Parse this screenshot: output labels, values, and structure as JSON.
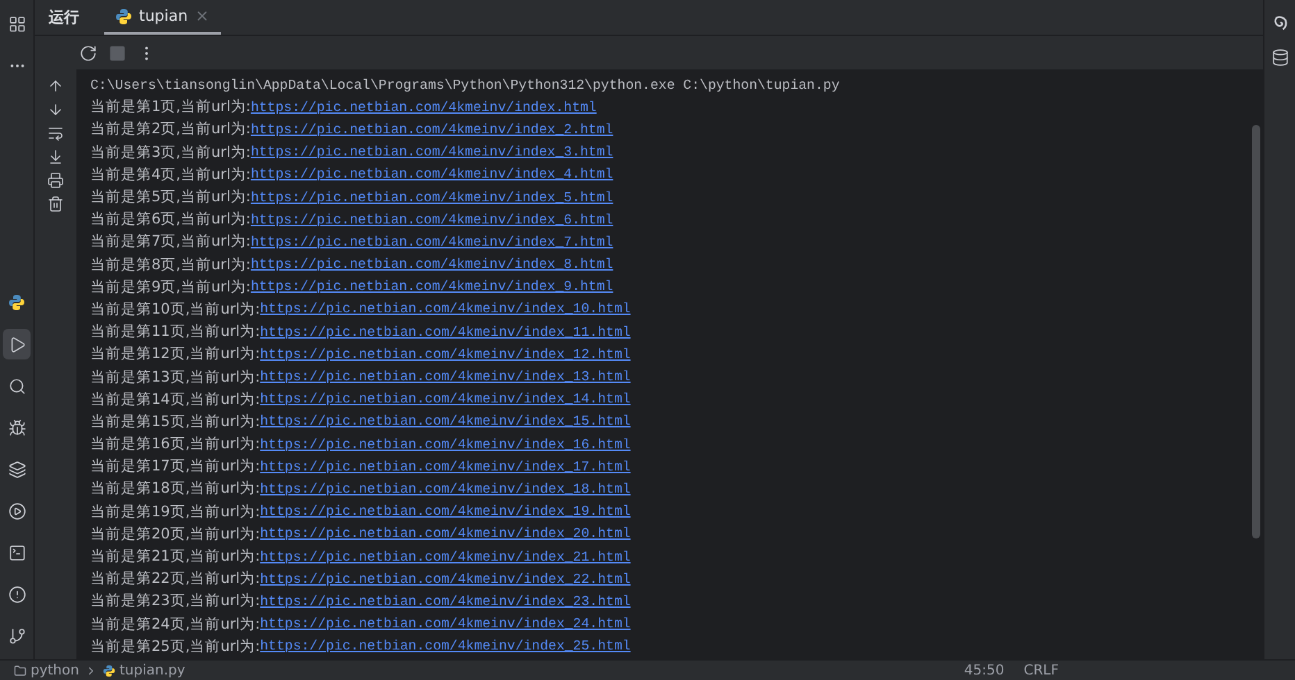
{
  "left_toolbar": {
    "top": [
      {
        "kind": "structure",
        "selected": false
      },
      {
        "kind": "more",
        "selected": false
      }
    ],
    "bottom": [
      {
        "kind": "python",
        "selected": false
      },
      {
        "kind": "run",
        "selected": true
      },
      {
        "kind": "search",
        "selected": false
      },
      {
        "kind": "debug",
        "selected": false
      },
      {
        "kind": "layers",
        "selected": false
      },
      {
        "kind": "services",
        "selected": false
      },
      {
        "kind": "terminal",
        "selected": false
      },
      {
        "kind": "problems",
        "selected": false
      },
      {
        "kind": "git",
        "selected": false
      }
    ]
  },
  "run_panel": {
    "title": "运行",
    "tabs": [
      {
        "label": "tupian",
        "selected": true
      }
    ],
    "actions": [
      {
        "kind": "rerun"
      },
      {
        "kind": "stop"
      },
      {
        "kind": "more"
      }
    ],
    "side_actions": [
      {
        "kind": "up"
      },
      {
        "kind": "down"
      },
      {
        "kind": "wrap"
      },
      {
        "kind": "scroll-end"
      },
      {
        "kind": "print"
      },
      {
        "kind": "trash"
      }
    ],
    "command": "C:\\Users\\tiansonglin\\AppData\\Local\\Programs\\Python\\Python312\\python.exe C:\\python\\tupian.py",
    "lines": [
      {
        "prefix": "当前是第1页,当前url为:",
        "url": "https://pic.netbian.com/4kmeinv/index.html"
      },
      {
        "prefix": "当前是第2页,当前url为:",
        "url": "https://pic.netbian.com/4kmeinv/index_2.html"
      },
      {
        "prefix": "当前是第3页,当前url为:",
        "url": "https://pic.netbian.com/4kmeinv/index_3.html"
      },
      {
        "prefix": "当前是第4页,当前url为:",
        "url": "https://pic.netbian.com/4kmeinv/index_4.html"
      },
      {
        "prefix": "当前是第5页,当前url为:",
        "url": "https://pic.netbian.com/4kmeinv/index_5.html"
      },
      {
        "prefix": "当前是第6页,当前url为:",
        "url": "https://pic.netbian.com/4kmeinv/index_6.html"
      },
      {
        "prefix": "当前是第7页,当前url为:",
        "url": "https://pic.netbian.com/4kmeinv/index_7.html"
      },
      {
        "prefix": "当前是第8页,当前url为:",
        "url": "https://pic.netbian.com/4kmeinv/index_8.html"
      },
      {
        "prefix": "当前是第9页,当前url为:",
        "url": "https://pic.netbian.com/4kmeinv/index_9.html"
      },
      {
        "prefix": "当前是第10页,当前url为:",
        "url": "https://pic.netbian.com/4kmeinv/index_10.html"
      },
      {
        "prefix": "当前是第11页,当前url为:",
        "url": "https://pic.netbian.com/4kmeinv/index_11.html"
      },
      {
        "prefix": "当前是第12页,当前url为:",
        "url": "https://pic.netbian.com/4kmeinv/index_12.html"
      },
      {
        "prefix": "当前是第13页,当前url为:",
        "url": "https://pic.netbian.com/4kmeinv/index_13.html"
      },
      {
        "prefix": "当前是第14页,当前url为:",
        "url": "https://pic.netbian.com/4kmeinv/index_14.html"
      },
      {
        "prefix": "当前是第15页,当前url为:",
        "url": "https://pic.netbian.com/4kmeinv/index_15.html"
      },
      {
        "prefix": "当前是第16页,当前url为:",
        "url": "https://pic.netbian.com/4kmeinv/index_16.html"
      },
      {
        "prefix": "当前是第17页,当前url为:",
        "url": "https://pic.netbian.com/4kmeinv/index_17.html"
      },
      {
        "prefix": "当前是第18页,当前url为:",
        "url": "https://pic.netbian.com/4kmeinv/index_18.html"
      },
      {
        "prefix": "当前是第19页,当前url为:",
        "url": "https://pic.netbian.com/4kmeinv/index_19.html"
      },
      {
        "prefix": "当前是第20页,当前url为:",
        "url": "https://pic.netbian.com/4kmeinv/index_20.html"
      },
      {
        "prefix": "当前是第21页,当前url为:",
        "url": "https://pic.netbian.com/4kmeinv/index_21.html"
      },
      {
        "prefix": "当前是第22页,当前url为:",
        "url": "https://pic.netbian.com/4kmeinv/index_22.html"
      },
      {
        "prefix": "当前是第23页,当前url为:",
        "url": "https://pic.netbian.com/4kmeinv/index_23.html"
      },
      {
        "prefix": "当前是第24页,当前url为:",
        "url": "https://pic.netbian.com/4kmeinv/index_24.html"
      },
      {
        "prefix": "当前是第25页,当前url为:",
        "url": "https://pic.netbian.com/4kmeinv/index_25.html"
      }
    ]
  },
  "right_toolbar": [
    {
      "kind": "spiral"
    },
    {
      "kind": "database"
    }
  ],
  "status_bar": {
    "breadcrumb": [
      "python",
      "tupian.py"
    ],
    "items": [
      "45:50",
      "CRLF"
    ]
  }
}
